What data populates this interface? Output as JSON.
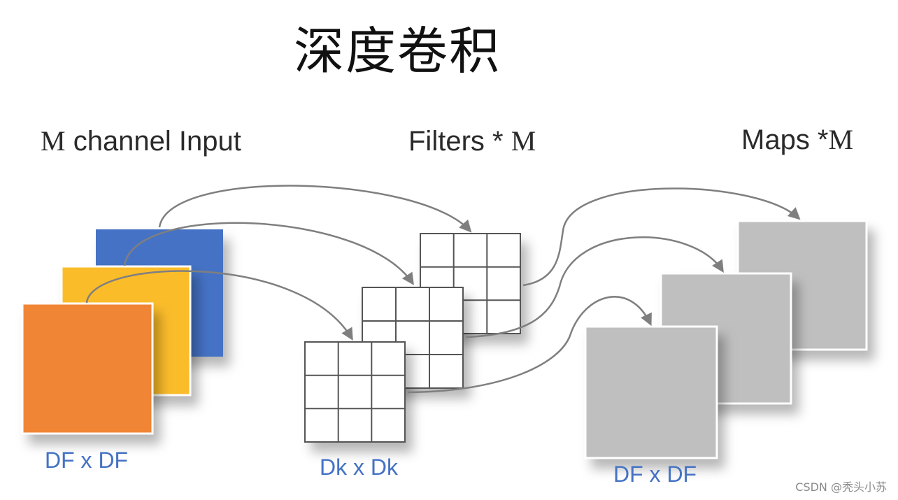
{
  "title": "深度卷积",
  "labels": {
    "input_prefix": "M",
    "input_text": " channel Input",
    "filters_text": "Filters * ",
    "filters_suffix": "M",
    "maps_text": "Maps *",
    "maps_suffix": "M"
  },
  "dimensions": {
    "input": "DF x DF",
    "filter": "Dk x Dk",
    "map": "DF x DF"
  },
  "colors": {
    "channel_back": "#4472c4",
    "channel_mid": "#fbbc2b",
    "channel_front": "#f08535",
    "filter_grid": "#555555",
    "map": "#bfbfbf",
    "arrow": "#7f7f7f",
    "dim_text": "#4472c4"
  },
  "watermark": "CSDN @秃头小苏"
}
